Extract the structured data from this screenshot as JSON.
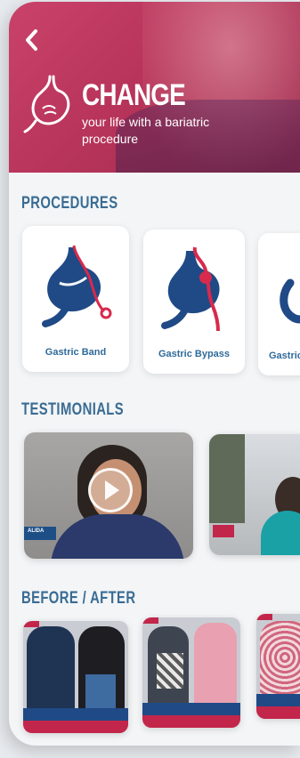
{
  "hero": {
    "title": "CHANGE",
    "subtitle": "your life with a bariatric procedure",
    "colors": {
      "hero": "#b8345a",
      "section_title": "#3a6c93",
      "accent_red": "#c3264b",
      "navy": "#1f4a86"
    }
  },
  "nav": {
    "back_icon": "chevron-left-icon"
  },
  "sections": {
    "procedures": "PROCEDURES",
    "testimonials": "TESTIMONIALS",
    "before_after": "BEFORE / AFTER"
  },
  "procedures": [
    {
      "label": "Gastric Band"
    },
    {
      "label": "Gastric Bypass"
    },
    {
      "label": "Gastric Sleeve"
    }
  ],
  "testimonials": [
    {
      "name_tag": "ALIDA"
    },
    {
      "name_tag": ""
    }
  ]
}
